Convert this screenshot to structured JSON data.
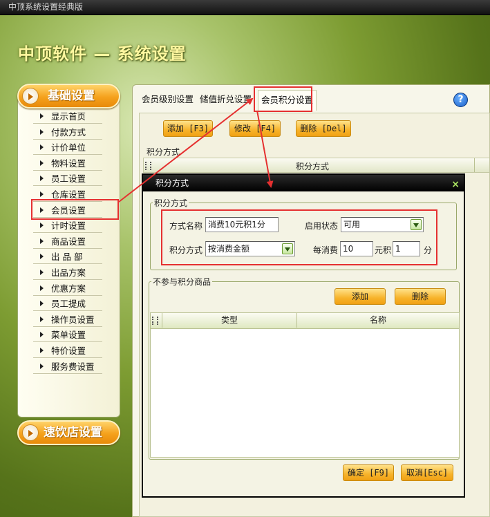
{
  "window": {
    "title": "中顶系统设置经典版"
  },
  "header": {
    "title": "中顶软件 — 系统设置"
  },
  "sidebar": {
    "section_basic": "基础设置",
    "section_fastfood": "速饮店设置",
    "items": [
      {
        "label": "显示首页"
      },
      {
        "label": "付款方式"
      },
      {
        "label": "计价单位"
      },
      {
        "label": "物料设置"
      },
      {
        "label": "员工设置"
      },
      {
        "label": "仓库设置"
      },
      {
        "label": "会员设置"
      },
      {
        "label": "计时设置"
      },
      {
        "label": "商品设置"
      },
      {
        "label": "出 品 部"
      },
      {
        "label": "出品方案"
      },
      {
        "label": "优惠方案"
      },
      {
        "label": "员工提成"
      },
      {
        "label": "操作员设置"
      },
      {
        "label": "菜单设置"
      },
      {
        "label": "特价设置"
      },
      {
        "label": "服务费设置"
      }
    ]
  },
  "tabs": [
    {
      "label": "会员级别设置"
    },
    {
      "label": "储值折兑设置"
    },
    {
      "label": "会员积分设置"
    }
  ],
  "help": {
    "glyph": "?"
  },
  "toolbar": {
    "add": "添加 [F3]",
    "edit": "修改 [F4]",
    "delete": "删除 [Del]"
  },
  "background_grid": {
    "group_title": "积分方式",
    "column": "积分方式"
  },
  "dialog": {
    "title": "积分方式",
    "close": "×",
    "group_method": "积分方式",
    "name_label": "方式名称",
    "name_value": "消费10元积1分",
    "status_label": "启用状态",
    "status_value": "可用",
    "method_label": "积分方式",
    "method_value": "按消费金额",
    "per_spend_label": "每消费",
    "per_spend_value": "10",
    "yuan_label": "元积",
    "points_value": "1",
    "points_unit": "分",
    "group_excluded": "不参与积分商品",
    "add_button": "添加",
    "delete_button": "删除",
    "columns": [
      "类型",
      "名称"
    ],
    "ok_button": "确定 [F9]",
    "cancel_button": "取消[Esc]"
  },
  "colors": {
    "annotation": "#e53030",
    "accent": "#f5a11c"
  }
}
